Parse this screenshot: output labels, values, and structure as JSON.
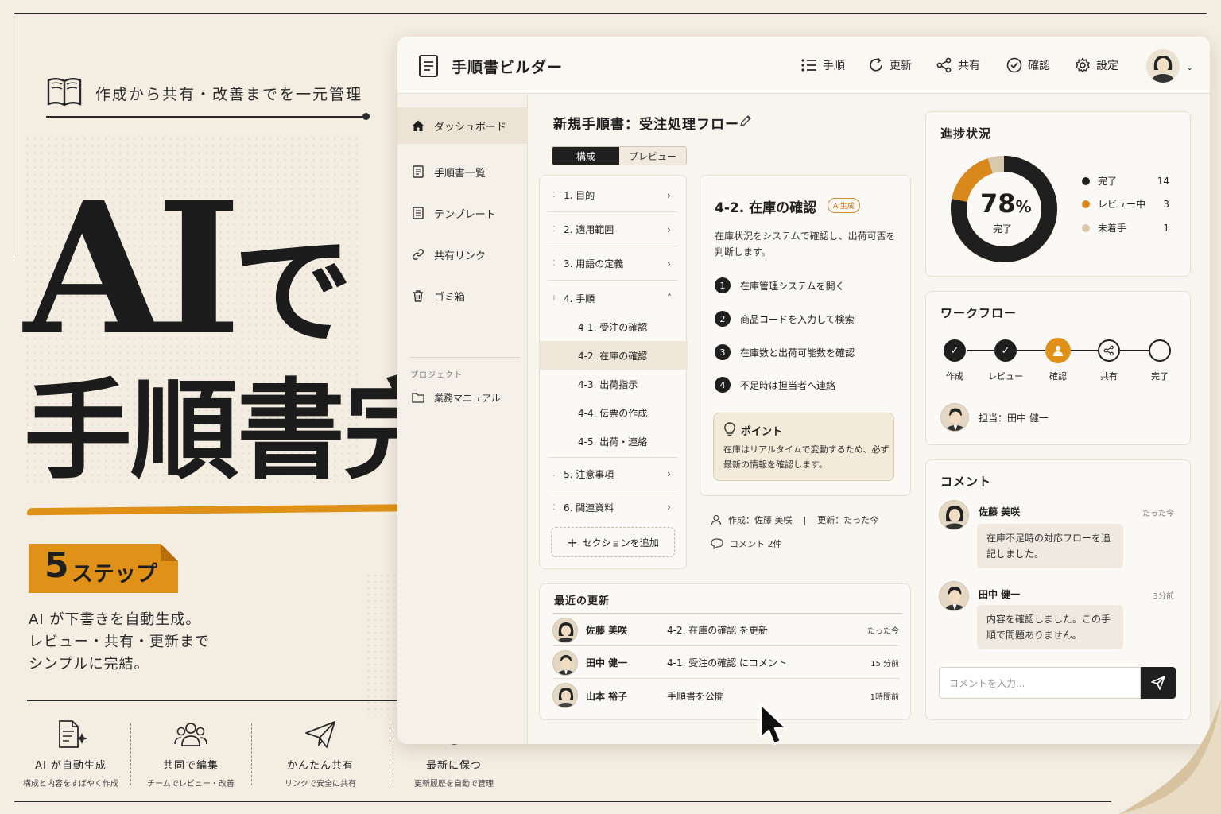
{
  "hero": {
    "tagline": "作成から共有・改善までを一元管理",
    "line1_ai": "AI",
    "line1_de": "で",
    "line2": "手順書完成",
    "steps_num": "5",
    "steps_label": "ステップ",
    "desc": [
      "AI が下書きを自動生成。",
      "レビュー・共有・更新まで",
      "シンプルに完結。"
    ]
  },
  "features": [
    {
      "icon": "ai-doc-icon",
      "title": "AI が自動生成",
      "sub": "構成と内容をすばやく作成"
    },
    {
      "icon": "team-icon",
      "title": "共同で編集",
      "sub": "チームでレビュー・改善"
    },
    {
      "icon": "paper-plane-icon",
      "title": "かんたん共有",
      "sub": "リンクで安全に共有"
    },
    {
      "icon": "refresh-icon",
      "title": "最新に保つ",
      "sub": "更新履歴を自動で管理"
    }
  ],
  "app": {
    "title": "手順書ビルダー",
    "nav": [
      {
        "label": "手順",
        "icon": "list-icon"
      },
      {
        "label": "更新",
        "icon": "refresh-icon"
      },
      {
        "label": "共有",
        "icon": "share-icon"
      },
      {
        "label": "確認",
        "icon": "check-circle-icon"
      },
      {
        "label": "設定",
        "icon": "gear-icon"
      }
    ]
  },
  "sidebar": {
    "items": [
      {
        "label": "ダッシュボード",
        "icon": "home-icon"
      },
      {
        "label": "手順書一覧",
        "icon": "document-icon"
      },
      {
        "label": "テンプレート",
        "icon": "template-icon"
      },
      {
        "label": "共有リンク",
        "icon": "link-icon"
      },
      {
        "label": "ゴミ箱",
        "icon": "trash-icon"
      }
    ],
    "project_label": "プロジェクト",
    "project_item": "業務マニュアル"
  },
  "doc": {
    "title": "新規手順書：受注処理フロー",
    "tabs": [
      "構成",
      "プレビュー"
    ],
    "active_tab": "構成"
  },
  "toc": {
    "sections": [
      "1. 目的",
      "2. 適用範囲",
      "3. 用語の定義",
      "4. 手順"
    ],
    "subs": [
      "4-1. 受注の確認",
      "4-2. 在庫の確認",
      "4-3. 出荷指示",
      "4-4. 伝票の作成",
      "4-5. 出荷・連絡"
    ],
    "selected_sub": "4-2. 在庫の確認",
    "after": [
      "5. 注意事項",
      "6. 関連資料"
    ],
    "add_label": "セクションを追加"
  },
  "detail": {
    "title": "4-2. 在庫の確認",
    "badge": "AI生成",
    "desc": "在庫状況をシステムで確認し、出荷可否を判断します。",
    "steps": [
      "在庫管理システムを開く",
      "商品コードを入力して検索",
      "在庫数と出荷可能数を確認",
      "不足時は担当者へ連絡"
    ],
    "point_title": "ポイント",
    "point_body": "在庫はリアルタイムで変動するため、必ず最新の情報を確認します。",
    "meta_author": "作成：佐藤 美咲",
    "meta_updated": "更新：たった今",
    "meta_comments": "コメント 2件"
  },
  "progress": {
    "title": "進捗状況",
    "percent_num": "78",
    "percent_sign": "%",
    "percent_label": "完了",
    "done_fraction": 0.78,
    "review_fraction": 0.17,
    "legend": [
      {
        "label": "完了",
        "value": "14",
        "color": "#1f1f1f"
      },
      {
        "label": "レビュー中",
        "value": "3",
        "color": "#d9891b"
      },
      {
        "label": "未着手",
        "value": "1",
        "color": "#d8c8ad"
      }
    ]
  },
  "workflow": {
    "title": "ワークフロー",
    "steps": [
      "作成",
      "レビュー",
      "確認",
      "共有",
      "完了"
    ],
    "assignee": "担当：田中 健一"
  },
  "comments": {
    "title": "コメント",
    "items": [
      {
        "name": "佐藤 美咲",
        "time": "たった今",
        "text": "在庫不足時の対応フローを追記しました。"
      },
      {
        "name": "田中 健一",
        "time": "3分前",
        "text": "内容を確認しました。この手順で問題ありません。"
      }
    ],
    "placeholder": "コメントを入力..."
  },
  "recent": {
    "title": "最近の更新",
    "rows": [
      {
        "name": "佐藤 美咲",
        "action": "4-2. 在庫の確認 を更新",
        "time": "たった今"
      },
      {
        "name": "田中 健一",
        "action": "4-1. 受注の確認 にコメント",
        "time": "15 分前"
      },
      {
        "name": "山本 裕子",
        "action": "手順書を公開",
        "time": "1時間前"
      }
    ]
  },
  "colors": {
    "accent": "#de9116",
    "ink": "#1f1f1f",
    "paper": "#f3ede2"
  }
}
